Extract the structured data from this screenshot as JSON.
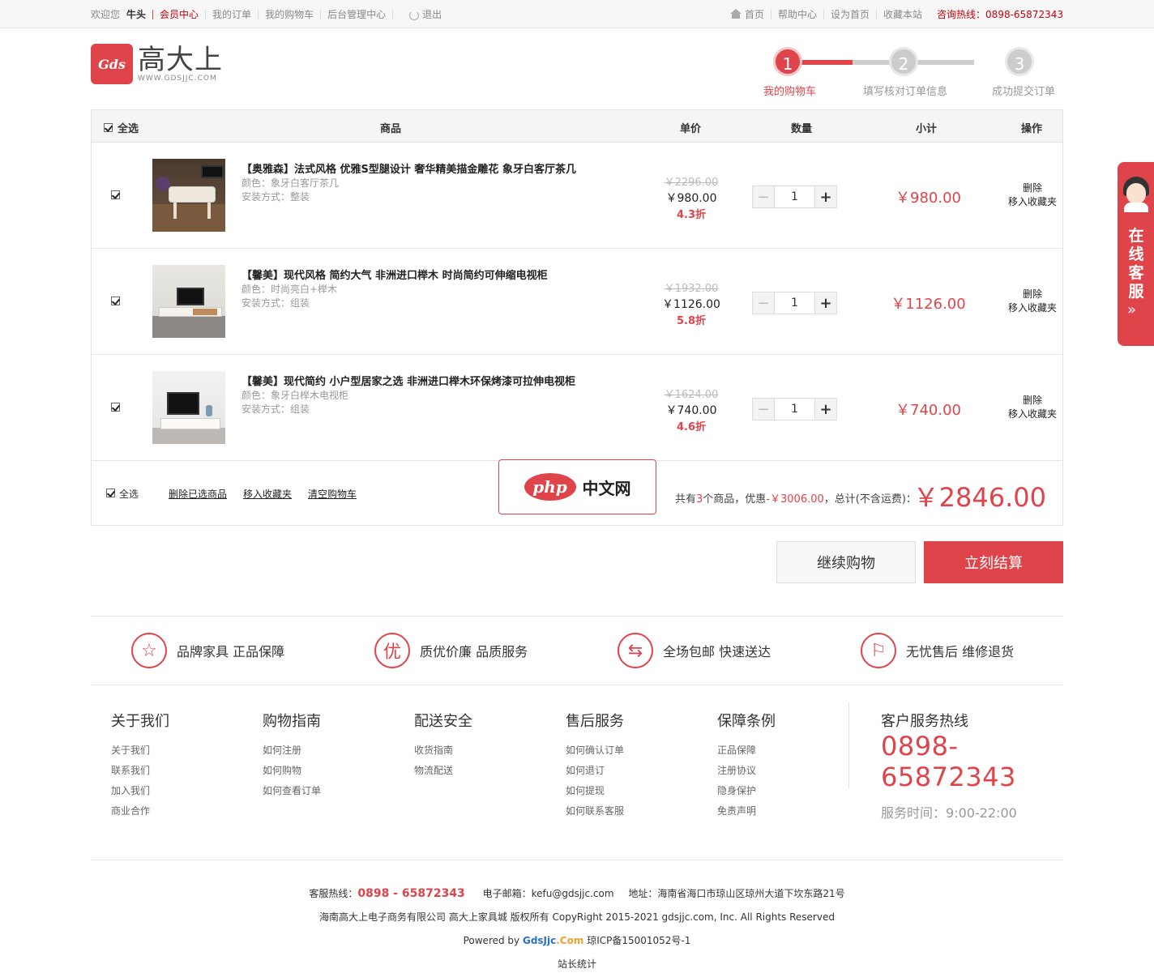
{
  "topbar": {
    "welcome": "欢迎您",
    "username": "牛头",
    "links": [
      "会员中心",
      "我的订单",
      "我的购物车",
      "后台管理中心"
    ],
    "logout": "退出",
    "right_links": [
      "首页",
      "帮助中心",
      "设为首页",
      "收藏本站"
    ],
    "hotline": "咨询热线：0898-65872343"
  },
  "logo": {
    "mark": "Gds",
    "cn": "高大上",
    "en": "WWW.GDSJJC.COM"
  },
  "steps": [
    {
      "num": "1",
      "label": "我的购物车"
    },
    {
      "num": "2",
      "label": "填写核对订单信息"
    },
    {
      "num": "3",
      "label": "成功提交订单"
    }
  ],
  "cart": {
    "headers": {
      "select_all": "全选",
      "goods": "商品",
      "price": "单价",
      "qty": "数量",
      "subtotal": "小计",
      "ops": "操作"
    },
    "items": [
      {
        "title": "【奥雅森】法式风格 优雅S型腿设计 奢华精美描金雕花 象牙白客厅茶几",
        "color": "颜色：象牙白客厅茶几",
        "install": "安装方式：整装",
        "old_price": "￥2296.00",
        "price": "￥980.00",
        "discount": "4.3折",
        "qty": "1",
        "subtotal": "￥980.00",
        "op_delete": "删除",
        "op_fav": "移入收藏夹"
      },
      {
        "title": "【馨美】现代风格 简约大气 非洲进口榉木 时尚简约可伸缩电视柜",
        "color": "颜色：时尚亮白+榉木",
        "install": "安装方式：组装",
        "old_price": "￥1932.00",
        "price": "￥1126.00",
        "discount": "5.8折",
        "qty": "1",
        "subtotal": "￥1126.00",
        "op_delete": "删除",
        "op_fav": "移入收藏夹"
      },
      {
        "title": "【馨美】现代简约 小户型居家之选 非洲进口榉木环保烤漆可拉伸电视柜",
        "color": "颜色：象牙白榉木电视柜",
        "install": "安装方式：组装",
        "old_price": "￥1624.00",
        "price": "￥740.00",
        "discount": "4.6折",
        "qty": "1",
        "subtotal": "￥740.00",
        "op_delete": "删除",
        "op_fav": "移入收藏夹"
      }
    ],
    "footer": {
      "select_all": "全选",
      "delete_selected": "删除已选商品",
      "move_fav": "移入收藏夹",
      "clear": "清空购物车",
      "sum_pre": "共有",
      "count": "3",
      "sum_mid": "个商品，优惠",
      "discount": "-￥3006.00",
      "sum_post": "，总计(不含运费)：",
      "total": "￥2846.00"
    }
  },
  "watermark": {
    "php": "php",
    "cn": "中文网"
  },
  "actions": {
    "continue": "继续购物",
    "checkout": "立刻结算"
  },
  "guarantees": [
    {
      "icon": "☆",
      "text": "品牌家具  正品保障"
    },
    {
      "icon": "优",
      "text": "质优价廉  品质服务"
    },
    {
      "icon": "⇆",
      "text": "全场包邮  快速送达"
    },
    {
      "icon": "⚐",
      "text": "无忧售后  维修退货"
    }
  ],
  "footer_cols": [
    {
      "title": "关于我们",
      "links": [
        "关于我们",
        "联系我们",
        "加入我们",
        "商业合作"
      ]
    },
    {
      "title": "购物指南",
      "links": [
        "如何注册",
        "如何购物",
        "如何查看订单"
      ]
    },
    {
      "title": "配送安全",
      "links": [
        "收货指南",
        "物流配送"
      ]
    },
    {
      "title": "售后服务",
      "links": [
        "如何确认订单",
        "如何退订",
        "如何提现",
        "如何联系客服"
      ]
    },
    {
      "title": "保障条例",
      "links": [
        "正品保障",
        "注册协议",
        "隐身保护",
        "免责声明"
      ]
    }
  ],
  "service_hotline": {
    "title": "客户服务热线",
    "number": "0898-65872343",
    "time": "服务时间：9:00-22:00"
  },
  "bottom": {
    "hot_label": "客服热线：",
    "hot_number": "0898 - 65872343",
    "email": "电子邮箱：kefu@gdsjjc.com",
    "address": "地址：海南省海口市琼山区琼州大道下坎东路21号",
    "copyright": "海南高大上电子商务有限公司 高大上家具城 版权所有 CopyRight 2015-2021 gdsjjc.com, Inc. All Rights Reserved",
    "powered": "Powered by ",
    "brand_a": "GdsJjc",
    "brand_b": ".Com",
    "icp": " 琼ICP备15001052号-1",
    "stats": "站长统计"
  },
  "side_service": {
    "text": "在线客服",
    "arrow": "»"
  },
  "colors": {
    "accent": "#e0444b",
    "text": "#333333",
    "muted": "#999999"
  }
}
